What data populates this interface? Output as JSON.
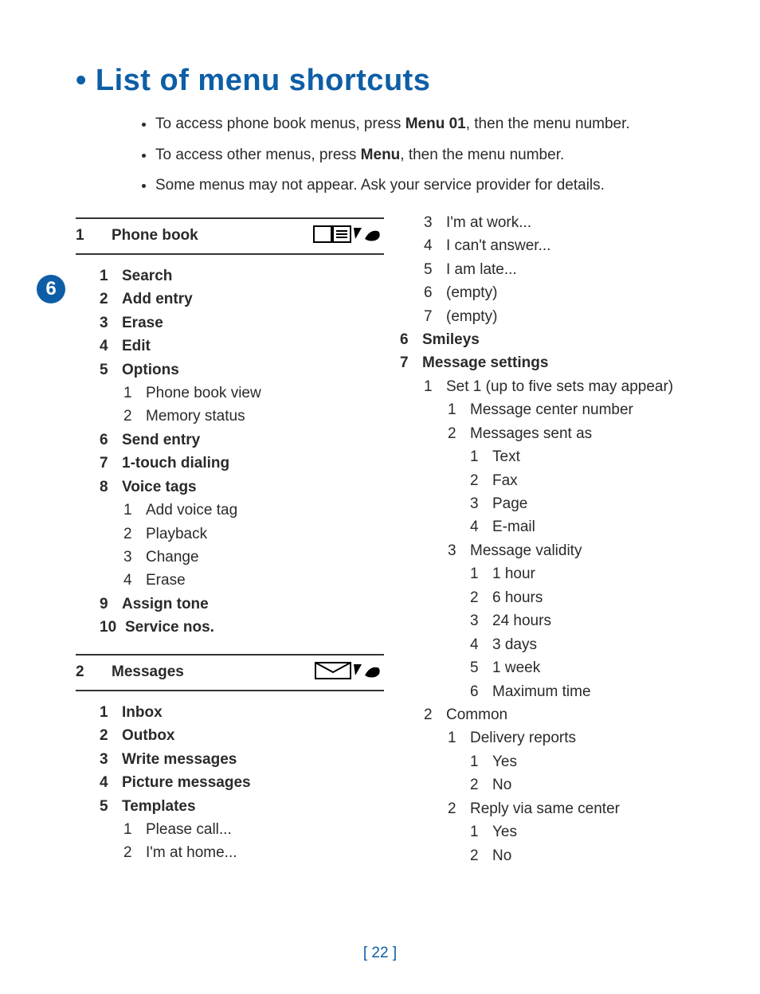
{
  "title": "• List of menu shortcuts",
  "intro": [
    {
      "pre": "To access phone book menus, press ",
      "bold": "Menu 01",
      "post": ", then the menu number."
    },
    {
      "pre": "To access other menus, press ",
      "bold": "Menu",
      "post": ", then the menu number."
    },
    {
      "pre": "Some menus may not appear. Ask your service provider for details.",
      "bold": "",
      "post": ""
    }
  ],
  "chapter_badge": "6",
  "section1": {
    "num": "1",
    "title": "Phone book"
  },
  "section2": {
    "num": "2",
    "title": "Messages"
  },
  "pb": {
    "i1": {
      "n": "1",
      "t": "Search"
    },
    "i2": {
      "n": "2",
      "t": "Add entry"
    },
    "i3": {
      "n": "3",
      "t": "Erase"
    },
    "i4": {
      "n": "4",
      "t": "Edit"
    },
    "i5": {
      "n": "5",
      "t": "Options"
    },
    "i5a": {
      "n": "1",
      "t": "Phone book view"
    },
    "i5b": {
      "n": "2",
      "t": "Memory status"
    },
    "i6": {
      "n": "6",
      "t": "Send entry"
    },
    "i7": {
      "n": "7",
      "t": "1-touch dialing"
    },
    "i8": {
      "n": "8",
      "t": "Voice tags"
    },
    "i8a": {
      "n": "1",
      "t": "Add voice tag"
    },
    "i8b": {
      "n": "2",
      "t": "Playback"
    },
    "i8c": {
      "n": "3",
      "t": "Change"
    },
    "i8d": {
      "n": "4",
      "t": "Erase"
    },
    "i9": {
      "n": "9",
      "t": "Assign tone"
    },
    "i10": {
      "n": "10",
      "t": "Service nos."
    }
  },
  "msg_left": {
    "i1": {
      "n": "1",
      "t": "Inbox"
    },
    "i2": {
      "n": "2",
      "t": "Outbox"
    },
    "i3": {
      "n": "3",
      "t": "Write messages"
    },
    "i4": {
      "n": "4",
      "t": "Picture messages"
    },
    "i5": {
      "n": "5",
      "t": "Templates"
    },
    "i5a": {
      "n": "1",
      "t": "Please call..."
    },
    "i5b": {
      "n": "2",
      "t": "I'm at home..."
    }
  },
  "msg_right": {
    "t3": {
      "n": "3",
      "t": "I'm at work..."
    },
    "t4": {
      "n": "4",
      "t": "I can't answer..."
    },
    "t5": {
      "n": "5",
      "t": "I am late..."
    },
    "t6": {
      "n": "6",
      "t": "(empty)"
    },
    "t7": {
      "n": "7",
      "t": "(empty)"
    },
    "i6": {
      "n": "6",
      "t": "Smileys"
    },
    "i7": {
      "n": "7",
      "t": "Message settings"
    },
    "s1": {
      "n": "1",
      "t": "Set 1 (up to five sets may appear)"
    },
    "s1a": {
      "n": "1",
      "t": "Message center number"
    },
    "s1b": {
      "n": "2",
      "t": "Messages sent as"
    },
    "s1b1": {
      "n": "1",
      "t": "Text"
    },
    "s1b2": {
      "n": "2",
      "t": "Fax"
    },
    "s1b3": {
      "n": "3",
      "t": "Page"
    },
    "s1b4": {
      "n": "4",
      "t": "E-mail"
    },
    "s1c": {
      "n": "3",
      "t": "Message validity"
    },
    "s1c1": {
      "n": "1",
      "t": "1 hour"
    },
    "s1c2": {
      "n": "2",
      "t": "6 hours"
    },
    "s1c3": {
      "n": "3",
      "t": "24 hours"
    },
    "s1c4": {
      "n": "4",
      "t": "3 days"
    },
    "s1c5": {
      "n": "5",
      "t": "1 week"
    },
    "s1c6": {
      "n": "6",
      "t": "Maximum time"
    },
    "s2": {
      "n": "2",
      "t": "Common"
    },
    "s2a": {
      "n": "1",
      "t": "Delivery reports"
    },
    "s2a1": {
      "n": "1",
      "t": "Yes"
    },
    "s2a2": {
      "n": "2",
      "t": "No"
    },
    "s2b": {
      "n": "2",
      "t": "Reply via same center"
    },
    "s2b1": {
      "n": "1",
      "t": "Yes"
    },
    "s2b2": {
      "n": "2",
      "t": "No"
    }
  },
  "page_number": "[ 22 ]"
}
